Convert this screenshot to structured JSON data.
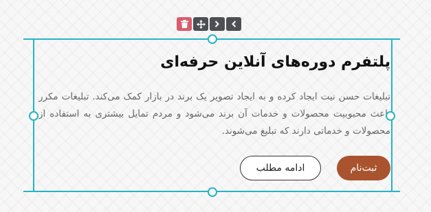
{
  "toolbar": {
    "icons": [
      "trash-icon",
      "move-icon",
      "chevron-right-icon",
      "chevron-left-icon"
    ],
    "colors": {
      "default": "#4d4f54",
      "delete": "#d95c6d"
    }
  },
  "selection": {
    "color": "#24b4c6"
  },
  "hero": {
    "title": "پلتفرم دوره‌های آنلاین حرفه‌ای",
    "paragraph": "تبلیغات حسن نیت ایجاد کرده و به ایجاد تصویر یک برند در بازار کمک می‌کند. تبلیغات مکرر باعث محبوبیت محصولات و خدمات آن برند می‌شود و مردم تمایل بیشتری به استفاده از محصولات و خدماتی دارند که تبلیغ می‌شوند.",
    "primary_button": "ثبت‌نام",
    "secondary_button": "ادامه مطلب",
    "accent_color": "#a9542f"
  }
}
